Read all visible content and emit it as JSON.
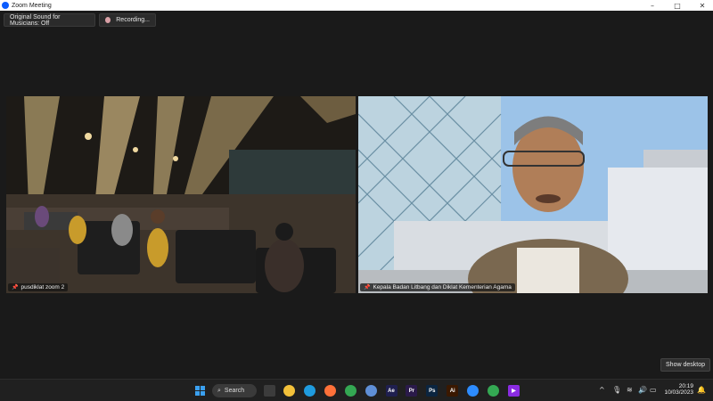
{
  "window": {
    "title": "Zoom Meeting",
    "controls": {
      "minimize": "–",
      "maximize": "□",
      "close": "✕"
    }
  },
  "top_bar": {
    "original_sound": "Original Sound for Musicians: Off",
    "recording": "Recording..."
  },
  "tiles": [
    {
      "name": "pusdiklat zoom 2",
      "icon": "pin-icon"
    },
    {
      "name": "Kepala Badan Litbang dan Diklat Kementerian Agama",
      "icon": "pin-icon"
    }
  ],
  "show_desktop": "Show desktop",
  "taskbar": {
    "search_label": "Search",
    "apps": [
      {
        "name": "file-explorer-icon",
        "glyph": "",
        "color": "#f3c13a"
      },
      {
        "name": "edge-icon",
        "glyph": "",
        "color": "#1f9bde"
      },
      {
        "name": "firefox-icon",
        "glyph": "",
        "color": "#ff7139"
      },
      {
        "name": "chrome-icon",
        "glyph": "",
        "color": "#34a853"
      },
      {
        "name": "chrome-dev-icon",
        "glyph": "",
        "color": "#5f8fd6"
      },
      {
        "name": "after-effects-icon",
        "glyph": "Ae",
        "color": "#1f1f4f"
      },
      {
        "name": "premiere-icon",
        "glyph": "Pr",
        "color": "#2a1a4a"
      },
      {
        "name": "photoshop-icon",
        "glyph": "Ps",
        "color": "#0b2540"
      },
      {
        "name": "illustrator-icon",
        "glyph": "Ai",
        "color": "#3a1800"
      },
      {
        "name": "zoom-icon",
        "glyph": "",
        "color": "#2d8cff"
      },
      {
        "name": "chrome-alt-icon",
        "glyph": "",
        "color": "#34a853"
      },
      {
        "name": "media-player-icon",
        "glyph": "▶",
        "color": "#8a2be2"
      }
    ],
    "time": "20:19",
    "date": "10/03/2023"
  }
}
